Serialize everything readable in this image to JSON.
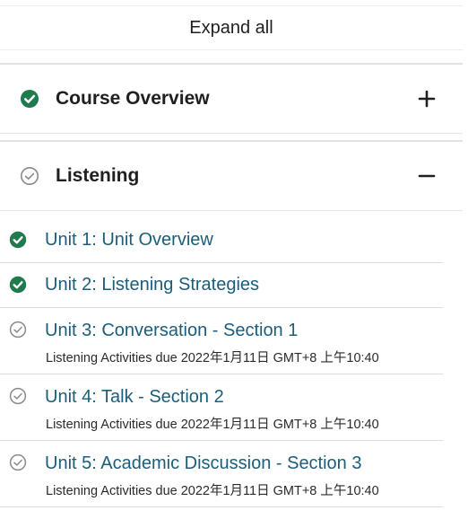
{
  "expand_all_label": "Expand all",
  "colors": {
    "complete": "#1f7a4d",
    "incomplete": "#8a8a8a",
    "link": "#1b5d7a"
  },
  "sections": [
    {
      "title": "Course Overview",
      "status": "complete",
      "toggle_icon": "plus-icon"
    },
    {
      "title": "Listening",
      "status": "incomplete",
      "toggle_icon": "minus-icon"
    }
  ],
  "units": [
    {
      "title": "Unit 1: Unit Overview",
      "status": "complete",
      "due": ""
    },
    {
      "title": "Unit 2: Listening Strategies",
      "status": "complete",
      "due": ""
    },
    {
      "title": "Unit 3: Conversation - Section 1",
      "status": "incomplete",
      "due": "Listening Activities due 2022年1月11日 GMT+8 上午10:40"
    },
    {
      "title": "Unit 4: Talk - Section 2",
      "status": "incomplete",
      "due": "Listening Activities due 2022年1月11日 GMT+8 上午10:40"
    },
    {
      "title": "Unit 5: Academic Discussion - Section 3",
      "status": "incomplete",
      "due": "Listening Activities due 2022年1月11日 GMT+8 上午10:40"
    }
  ]
}
